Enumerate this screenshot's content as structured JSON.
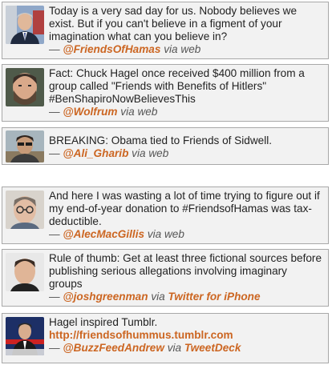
{
  "tweets": [
    {
      "avatar_icon": "avatar-gray-hair-man-suit",
      "text": "Today is a very sad day for us. Nobody believes we exist. But if you can't believe in a figment of your imagination what can you believe in?",
      "dash": "—",
      "handle": "@FriendsOfHamas",
      "via": "via",
      "client": "web"
    },
    {
      "avatar_icon": "avatar-bearded-man",
      "text": "Fact: Chuck Hagel once received $400 million from a group called \"Friends with Benefits of Hitlers\" #BenShapiroNowBelievesThis",
      "dash": "—",
      "handle": "@Wolfrum",
      "via": "via",
      "client": "web"
    },
    {
      "avatar_icon": "avatar-man-sunglasses",
      "text": "BREAKING: Obama tied to Friends of Sidwell.",
      "dash": "—",
      "handle": "@Ali_Gharib",
      "via": "via",
      "client": "web"
    },
    {
      "avatar_icon": "avatar-man-glasses",
      "text": "And here I was wasting a lot of time trying to figure out if my end-of-year donation to #FriendsofHamas was tax-deductible.",
      "dash": "—",
      "handle": "@AlecMacGillis",
      "via": "via",
      "client": "web"
    },
    {
      "avatar_icon": "avatar-man-short-hair",
      "text": "Rule of thumb: Get at least three fictional sources before publishing serious allegations involving imaginary groups",
      "dash": "—",
      "handle": "@joshgreenman",
      "via": "via",
      "client": "Twitter for iPhone"
    },
    {
      "avatar_icon": "avatar-news-anchor",
      "text": "Hagel inspired Tumblr.",
      "link": "http://friendsofhummus.tumblr.com",
      "dash": "—",
      "handle": "@BuzzFeedAndrew",
      "via": "via",
      "client": "TweetDeck"
    }
  ],
  "colors": {
    "accent": "#cc6622",
    "card_bg": "#f2f2f2",
    "border": "#a8a8a8",
    "text": "#222222",
    "meta": "#555555"
  }
}
